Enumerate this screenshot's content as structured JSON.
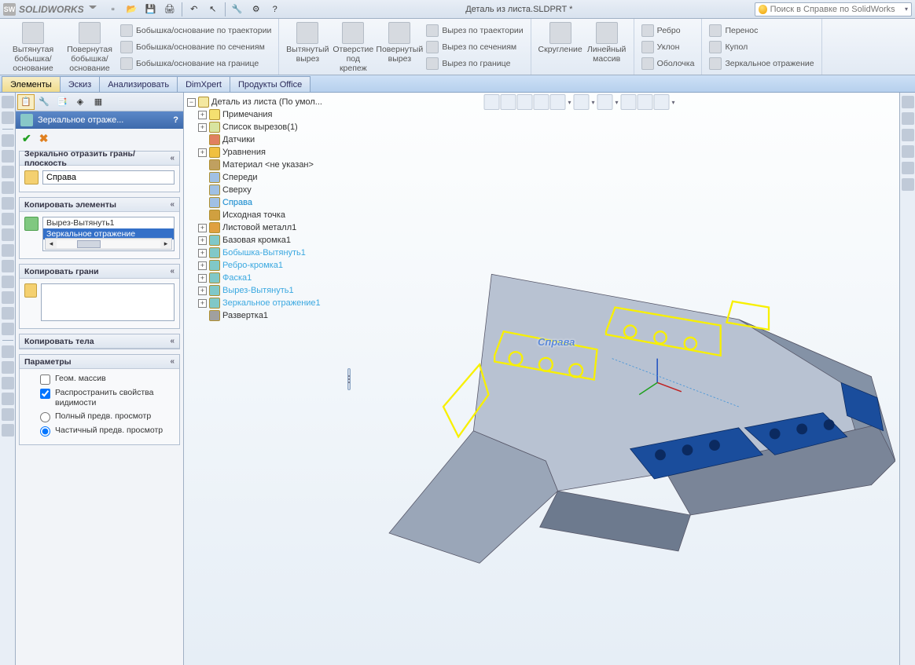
{
  "brand": "SOLIDWORKS",
  "documentTitle": "Деталь из листа.SLDPRT *",
  "searchPlaceholder": "Поиск в Справке по SolidWorks",
  "ribbon": {
    "g1": {
      "big1": "Вытянутая\nбобышка/основание",
      "big2": "Повернутая\nбобышка/основание",
      "r1": "Бобышка/основание по траектории",
      "r2": "Бобышка/основание по сечениям",
      "r3": "Бобышка/основание на границе"
    },
    "g2": {
      "big1": "Вытянутый\nвырез",
      "big2": "Отверстие\nпод\nкрепеж",
      "big3": "Повернутый\nвырез",
      "r1": "Вырез по траектории",
      "r2": "Вырез по сечениям",
      "r3": "Вырез по границе"
    },
    "g3": {
      "big1": "Скругление",
      "big2": "Линейный\nмассив"
    },
    "g4": {
      "r1": "Ребро",
      "r2": "Уклон",
      "r3": "Оболочка"
    },
    "g5": {
      "r1": "Перенос",
      "r2": "Купол",
      "r3": "Зеркальное отражение"
    }
  },
  "tabs": [
    "Элементы",
    "Эскиз",
    "Анализировать",
    "DimXpert",
    "Продукты Office"
  ],
  "pm": {
    "title": "Зеркальное отраже...",
    "sec1": {
      "h": "Зеркально отразить грань/плоскость",
      "val": "Справа"
    },
    "sec2": {
      "h": "Копировать элементы",
      "items": [
        "Вырез-Вытянуть1",
        "Зеркальное отражение"
      ]
    },
    "sec3": {
      "h": "Копировать грани"
    },
    "sec4": {
      "h": "Копировать тела"
    },
    "sec5": {
      "h": "Параметры",
      "chk1": "Геом. массив",
      "chk2": "Распространить свойства видимости",
      "rad1": "Полный предв. просмотр",
      "rad2": "Частичный предв. просмотр"
    }
  },
  "tree": {
    "root": "Деталь из листа  (По умол...",
    "items": [
      {
        "l": "Примечания",
        "c": "anno"
      },
      {
        "l": "Список вырезов(1)",
        "c": "list"
      },
      {
        "l": "Датчики",
        "c": "sens"
      },
      {
        "l": "Уравнения",
        "c": "eq"
      },
      {
        "l": "Материал <не указан>",
        "c": "mat"
      },
      {
        "l": "Спереди",
        "c": "pl"
      },
      {
        "l": "Сверху",
        "c": "pl"
      },
      {
        "l": "Справа",
        "c": "pl",
        "sel": true
      },
      {
        "l": "Исходная точка",
        "c": "org"
      },
      {
        "l": "Листовой металл1",
        "c": "sm"
      },
      {
        "l": "Базовая кромка1",
        "c": "fe"
      },
      {
        "l": "Бобышка-Вытянуть1",
        "c": "fe",
        "hl": true
      },
      {
        "l": "Ребро-кромка1",
        "c": "fe",
        "hl": true
      },
      {
        "l": "Фаска1",
        "c": "fe",
        "hl": true
      },
      {
        "l": "Вырез-Вытянуть1",
        "c": "fe",
        "hl": true
      },
      {
        "l": "Зеркальное отражение1",
        "c": "fe",
        "hl": true
      },
      {
        "l": "Развертка1",
        "c": "fl"
      }
    ]
  },
  "planeLabel": "Справа"
}
